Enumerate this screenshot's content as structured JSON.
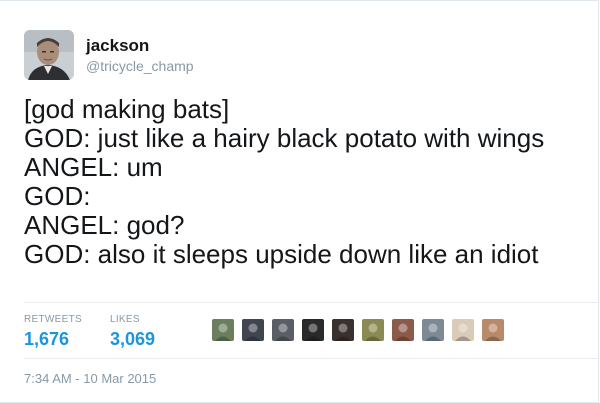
{
  "user": {
    "display_name": "jackson",
    "handle": "@tricycle_champ",
    "avatar_icon": "profile-photo"
  },
  "tweet": {
    "lines": [
      "[god making bats]",
      "GOD: just like a hairy black potato with wings",
      "ANGEL: um",
      "GOD:",
      "ANGEL: god?",
      "GOD: also it sleeps upside down like an idiot"
    ]
  },
  "stats": {
    "retweets_label": "RETWEETS",
    "retweets_value": "1,676",
    "likes_label": "LIKES",
    "likes_value": "3,069"
  },
  "likers": [
    {
      "icon": "liker-avatar-1",
      "color": "#6b7f5e"
    },
    {
      "icon": "liker-avatar-2",
      "color": "#3f4650"
    },
    {
      "icon": "liker-avatar-3",
      "color": "#5a5f66"
    },
    {
      "icon": "liker-avatar-4",
      "color": "#2a2a2a"
    },
    {
      "icon": "liker-avatar-5",
      "color": "#3a3030"
    },
    {
      "icon": "liker-avatar-6",
      "color": "#8a8a52"
    },
    {
      "icon": "liker-avatar-7",
      "color": "#8c5a4a"
    },
    {
      "icon": "liker-avatar-8",
      "color": "#7d8a96"
    },
    {
      "icon": "liker-avatar-9",
      "color": "#d9cbb7"
    },
    {
      "icon": "liker-avatar-10",
      "color": "#b88a6a"
    }
  ],
  "timestamp": "7:34 AM - 10 Mar 2015",
  "colors": {
    "link_blue": "#1b95e0",
    "muted_gray": "#8899a6",
    "text": "#14171a"
  }
}
